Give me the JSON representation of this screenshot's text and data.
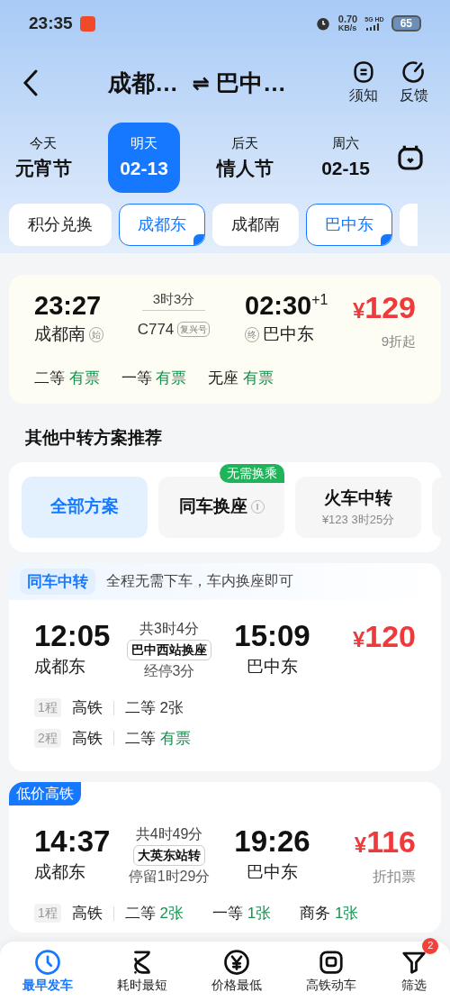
{
  "status_bar": {
    "time": "23:35",
    "net_speed": "0.70",
    "net_unit": "KB/s",
    "net_type": "5G HD",
    "battery": "65"
  },
  "header": {
    "from": "成都…",
    "swap": "⇌",
    "to": "巴中…",
    "actions": [
      {
        "kind": "notice",
        "label": "须知"
      },
      {
        "kind": "feedback",
        "label": "反馈"
      }
    ]
  },
  "dates": [
    {
      "top": "今天",
      "main": "元宵节",
      "selected": false
    },
    {
      "top": "明天",
      "main": "02-13",
      "selected": true
    },
    {
      "top": "后天",
      "main": "情人节",
      "selected": false
    },
    {
      "top": "周六",
      "main": "02-15",
      "selected": false
    }
  ],
  "stations": [
    {
      "label": "积分兑换",
      "selected": false
    },
    {
      "label": "成都东",
      "selected": true
    },
    {
      "label": "成都南",
      "selected": false
    },
    {
      "label": "巴中东",
      "selected": true
    }
  ],
  "direct_train": {
    "dep_time": "23:27",
    "dep_station": "成都南",
    "dep_tag": "始",
    "duration": "3时3分",
    "train_no": "C774",
    "train_type": "复兴号",
    "arr_time": "02:30",
    "arr_day": "+1",
    "arr_tag": "终",
    "arr_station": "巴中东",
    "currency": "¥",
    "price": "129",
    "price_note": "9折起",
    "seats": [
      {
        "class": "二等",
        "status": "有票",
        "highlight": true
      },
      {
        "class": "一等",
        "status": "有票",
        "highlight": true
      },
      {
        "class": "无座",
        "status": "有票",
        "highlight": true
      }
    ]
  },
  "section_title": "其他中转方案推荐",
  "plan_tabs": [
    {
      "label": "全部方案",
      "selected": true
    },
    {
      "label": "同车换座",
      "selected": false,
      "badge": "无需换乘",
      "info": true
    },
    {
      "label": "火车中转",
      "selected": false,
      "price": "¥123",
      "duration": "3时25分"
    }
  ],
  "transfers": [
    {
      "tag": {
        "kind": "banner",
        "text": "同车中转",
        "note": "全程无需下车，车内换座即可"
      },
      "dep_time": "12:05",
      "dep_station": "成都东",
      "total": "共3时4分",
      "via": "巴中西站换座",
      "stop": "经停3分",
      "arr_time": "15:09",
      "arr_station": "巴中东",
      "currency": "¥",
      "price": "120",
      "legs": [
        {
          "leg": "1程",
          "type": "高铁",
          "seats": [
            {
              "class": "二等",
              "status": "2张",
              "highlight": false
            }
          ]
        },
        {
          "leg": "2程",
          "type": "高铁",
          "seats": [
            {
              "class": "二等",
              "status": "有票",
              "highlight": true
            }
          ]
        }
      ]
    },
    {
      "tag": {
        "kind": "ribbon",
        "text": "低价高铁"
      },
      "dep_time": "14:37",
      "dep_station": "成都东",
      "total": "共4时49分",
      "via": "大英东站转",
      "stop": "停留1时29分",
      "arr_time": "19:26",
      "arr_station": "巴中东",
      "currency": "¥",
      "price": "116",
      "price_note": "折扣票",
      "legs": [
        {
          "leg": "1程",
          "type": "高铁",
          "seats": [
            {
              "class": "二等",
              "status": "2张",
              "highlight": true
            },
            {
              "class": "一等",
              "status": "1张",
              "highlight": true
            },
            {
              "class": "商务",
              "status": "1张",
              "highlight": true
            }
          ]
        }
      ]
    }
  ],
  "bottom_nav": [
    {
      "kind": "clock",
      "label": "最早发车",
      "selected": true
    },
    {
      "kind": "swirl",
      "label": "耗时最短",
      "selected": false
    },
    {
      "kind": "yen",
      "label": "价格最低",
      "selected": false
    },
    {
      "kind": "square",
      "label": "高铁动车",
      "selected": false
    },
    {
      "kind": "filter",
      "label": "筛选",
      "selected": false,
      "badge": "2"
    }
  ]
}
